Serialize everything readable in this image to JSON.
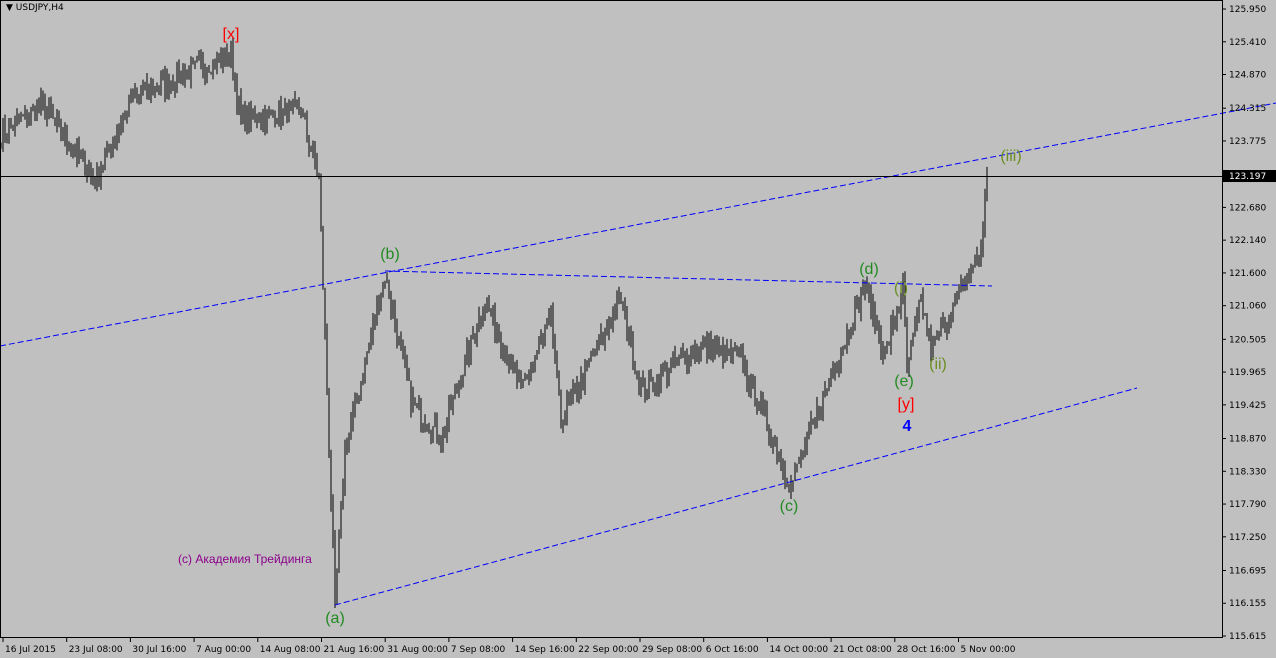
{
  "chart_data": {
    "type": "candlestick",
    "title": "USDJPY,H4",
    "symbol": "USDJPY",
    "timeframe": "H4",
    "ylim": [
      115.615,
      125.95
    ],
    "y_ticks": [
      "125.950",
      "125.410",
      "124.870",
      "124.315",
      "123.775",
      "123.197",
      "122.680",
      "122.140",
      "121.600",
      "121.060",
      "120.505",
      "119.965",
      "119.425",
      "118.870",
      "118.330",
      "117.790",
      "117.250",
      "116.695",
      "116.155",
      "115.615"
    ],
    "current_price": "123.197",
    "x_ticks": [
      "16 Jul 2015",
      "23 Jul 08:00",
      "30 Jul 16:00",
      "7 Aug 00:00",
      "14 Aug 08:00",
      "21 Aug 16:00",
      "31 Aug 00:00",
      "7 Sep 08:00",
      "14 Sep 16:00",
      "22 Sep 00:00",
      "29 Sep 08:00",
      "6 Oct 16:00",
      "14 Oct 00:00",
      "21 Oct 08:00",
      "28 Oct 16:00",
      "5 Nov 00:00"
    ],
    "price_path": [
      [
        0,
        123.87
      ],
      [
        20,
        124.37
      ],
      [
        47,
        123.13
      ],
      [
        65,
        124.45
      ],
      [
        90,
        124.86
      ],
      [
        115,
        125.19
      ],
      [
        120,
        124.12
      ],
      [
        150,
        124.29
      ],
      [
        159,
        123.13
      ],
      [
        167,
        116.15
      ],
      [
        172,
        118.68
      ],
      [
        192,
        121.57
      ],
      [
        205,
        119.5
      ],
      [
        220,
        118.85
      ],
      [
        242,
        121.15
      ],
      [
        260,
        119.67
      ],
      [
        275,
        120.83
      ],
      [
        280,
        119.17
      ],
      [
        310,
        121.15
      ],
      [
        320,
        119.67
      ],
      [
        350,
        120.41
      ],
      [
        370,
        120.17
      ],
      [
        395,
        118.1
      ],
      [
        415,
        119.9
      ],
      [
        432,
        121.4
      ],
      [
        442,
        120.25
      ],
      [
        451,
        121.32
      ],
      [
        453,
        120.0
      ],
      [
        460,
        121.15
      ],
      [
        465,
        120.33
      ],
      [
        480,
        121.32
      ],
      [
        490,
        121.98
      ],
      [
        493,
        123.2
      ]
    ],
    "annotations": [
      {
        "text": "[x]",
        "color": "#ff0000"
      },
      {
        "text": "(b)",
        "color": "#228b22"
      },
      {
        "text": "(d)",
        "color": "#228b22"
      },
      {
        "text": "(i)",
        "color": "#6b8e23"
      },
      {
        "text": "(iii)",
        "color": "#6b8e23"
      },
      {
        "text": "(e)",
        "color": "#228b22"
      },
      {
        "text": "(ii)",
        "color": "#6b8e23"
      },
      {
        "text": "[y]",
        "color": "#ff0000"
      },
      {
        "text": "4",
        "color": "#0000ff"
      },
      {
        "text": "(c)",
        "color": "#228b22"
      },
      {
        "text": "(a)",
        "color": "#228b22"
      }
    ],
    "copyright": "(c) Академия Трейдинга"
  }
}
